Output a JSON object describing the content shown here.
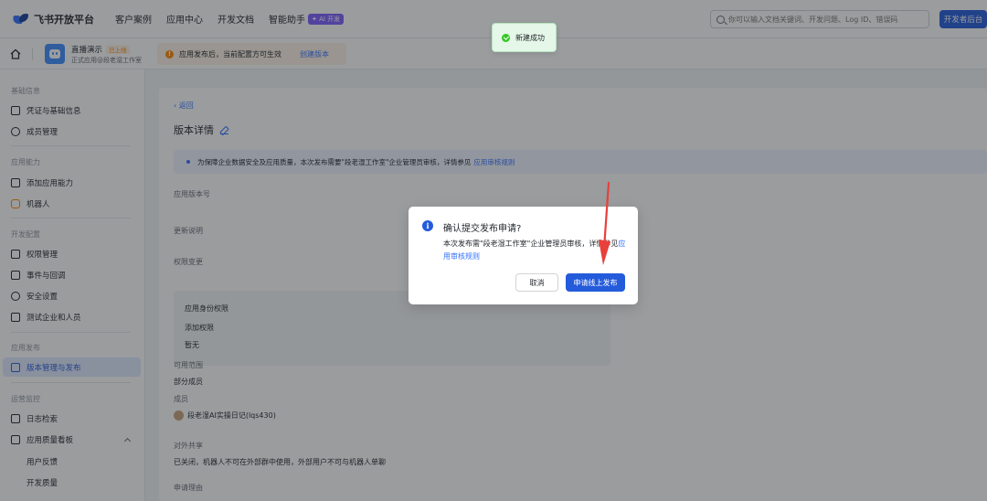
{
  "topnav": {
    "brand": "飞书开放平台",
    "links": [
      "客户案例",
      "应用中心",
      "开发文档",
      "智能助手"
    ],
    "ai_badge": "✦ AI 开发",
    "search_placeholder": "你可以输入文档关键词、开发问题、Log ID、错误码",
    "dev_console": "开发者后台"
  },
  "subheader": {
    "app_name": "直播演示",
    "app_status": "已上线",
    "app_sub": "正式应用@段老湿工作室",
    "notice": "应用发布后，当前配置方可生效",
    "notice_link": "创建版本"
  },
  "sidebar": {
    "sections": [
      {
        "title": "基础信息",
        "items": [
          "凭证与基础信息",
          "成员管理"
        ]
      },
      {
        "title": "应用能力",
        "items": [
          "添加应用能力",
          "机器人"
        ]
      },
      {
        "title": "开发配置",
        "items": [
          "权限管理",
          "事件与回调",
          "安全设置",
          "测试企业和人员"
        ]
      },
      {
        "title": "应用发布",
        "items": [
          "版本管理与发布"
        ]
      },
      {
        "title": "运营监控",
        "items": [
          "日志检索",
          "应用质量看板"
        ]
      }
    ],
    "sub_items": [
      "用户反馈",
      "开发质量"
    ]
  },
  "main": {
    "back": "返回",
    "title": "版本详情",
    "info": "为保障企业数据安全及应用质量，本次发布需要\"段老湿工作室\"企业管理员审核，详情参见",
    "info_link": "应用审核规则",
    "field_version": "应用版本号",
    "field_desc": "更新说明",
    "field_perm": "权限变更",
    "perm_rows": [
      "应用身份权限",
      "添加权限",
      "暂无"
    ],
    "field_scope": "可用范围",
    "scope_value": "部分成员",
    "members_label": "成员",
    "member_name": "段老湿AI实操日记(lqs430)",
    "external_label": "对外共享",
    "external_value": "已关闭，机器人不可在外部群中使用，外部用户不可与机器人单聊",
    "reason_label": "申请理由"
  },
  "toast": {
    "text": "新建成功"
  },
  "dialog": {
    "title": "确认提交发布申请?",
    "body": "本次发布需\"段老湿工作室\"企业管理员审核，详情参见",
    "link": "应用审核规则",
    "cancel": "取消",
    "confirm": "申请线上发布"
  },
  "colors": {
    "primary": "#245bdb",
    "annotation_arrow": "#e8403a",
    "toast_bg": "#e4f7e8",
    "notice_bg": "#fff3e5"
  }
}
